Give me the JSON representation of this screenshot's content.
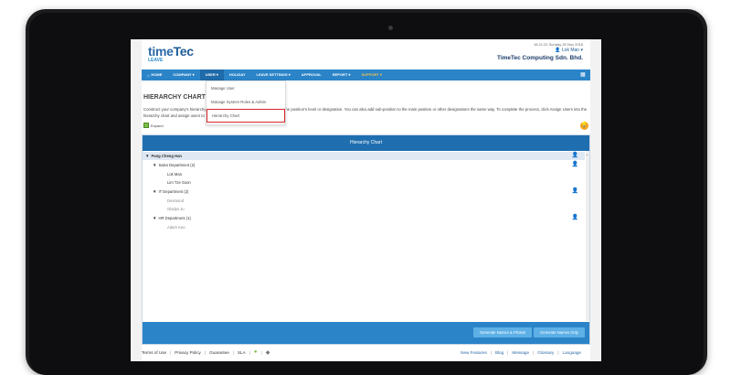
{
  "header": {
    "logo_main": "time",
    "logo_tec": "Tec",
    "logo_sub": "LEAVE",
    "timestamp": "15:21:22 Sunday 25 Nov 2018",
    "user": "Lok Man",
    "company": "TimeTec Computing Sdn. Bhd."
  },
  "nav": {
    "items": [
      "HOME",
      "COMPANY ▾",
      "USER ▾",
      "HOLIDAY",
      "LEAVE SETTINGS ▾",
      "APPROVAL",
      "REPORT ▾",
      "SUPPORT ▾"
    ]
  },
  "dropdown": {
    "items": [
      "Manage User",
      "Manage System Roles & Admin",
      "Hierarchy Chart"
    ]
  },
  "page": {
    "title": "HIERARCHY CHART",
    "description": "Construct your company's hierarchy chart by adding the main position and name the position's level or designation. You can also add sub-position to the main position or other designations the same way. To complete the process, click Assign Users into the hierarchy chart and assign users to the appropriate position.",
    "expand_label": "Expand"
  },
  "chart": {
    "title": "Hierarchy Chart",
    "root": "Pang Cheng Han",
    "departments": [
      {
        "label": "Sales Department",
        "count": "(2)",
        "members": [
          "Lok Man",
          "Lim Tze Soon"
        ]
      },
      {
        "label": "IT Department",
        "count": "(2)",
        "members": [
          "Desmond",
          "Gladys Ju"
        ]
      },
      {
        "label": "HR Department",
        "count": "(1)",
        "members": [
          "Adam Koo"
        ]
      }
    ],
    "btn_names_photos": "Generate Names & Photos",
    "btn_names_only": "Generate Names Only"
  },
  "footer": {
    "left": [
      "Terms of Use",
      "Privacy Policy",
      "Guarantee",
      "SLA"
    ],
    "right": [
      "New Features",
      "Blog",
      "Message",
      "Glossary",
      "Language"
    ]
  }
}
